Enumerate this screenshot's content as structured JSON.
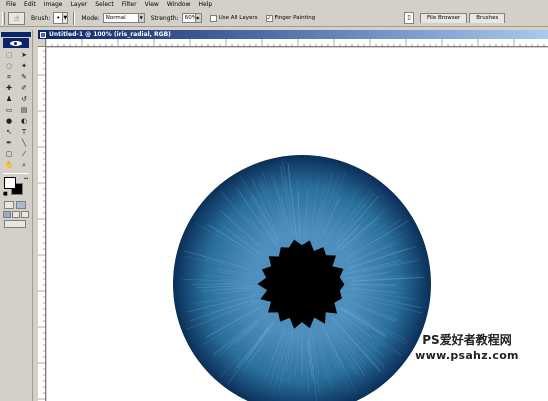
{
  "menu": {
    "items": [
      {
        "label": "File"
      },
      {
        "label": "Edit"
      },
      {
        "label": "Image"
      },
      {
        "label": "Layer"
      },
      {
        "label": "Select"
      },
      {
        "label": "Filter"
      },
      {
        "label": "View"
      },
      {
        "label": "Window"
      },
      {
        "label": "Help"
      }
    ]
  },
  "options_bar": {
    "brush_label": "Brush:",
    "mode_label": "Mode:",
    "mode_value": "Normal",
    "strength_label": "Strength:",
    "strength_value": "60%",
    "use_all_layers_label": "Use All Layers",
    "use_all_layers_checked": false,
    "finger_painting_label": "Finger Painting",
    "finger_painting_checked": true
  },
  "palette_well": {
    "tabs": [
      {
        "label": "File Browser"
      },
      {
        "label": "Brushes"
      }
    ]
  },
  "document": {
    "title": "Untitled-1 @ 100% (iris_radial, RGB)",
    "zoom": "100%",
    "layer": "iris_radial",
    "color_mode": "RGB"
  },
  "colors": {
    "iris_edge": "#0a2f58",
    "iris_mid": "#2a6f9c",
    "iris_inner": "#4e8fbe",
    "pupil": "#000000",
    "foreground": "#ffffff",
    "background": "#000000",
    "title_bar": "#0a246a"
  },
  "watermark": {
    "line1": "PS爱好者教程网",
    "line2": "www.psahz.com"
  }
}
